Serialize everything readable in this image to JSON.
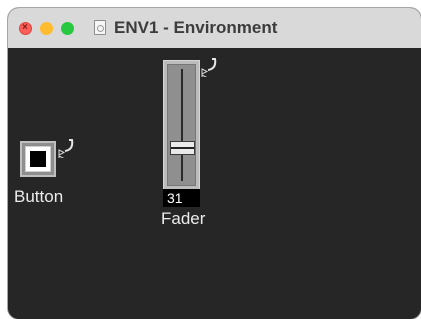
{
  "window": {
    "title": "ENV1 - Environment",
    "traffic_lights": {
      "close": {
        "color": "#fe5f57",
        "icon": "close-x-icon"
      },
      "minimize": {
        "color": "#febc2e"
      },
      "zoom": {
        "color": "#28c840"
      }
    },
    "document_icon": "document-icon"
  },
  "canvas": {
    "background": "#262626",
    "objects": {
      "button": {
        "label": "Button",
        "cable_icon": "cable-outlet-icon"
      },
      "fader": {
        "label": "Fader",
        "value": "31",
        "cable_icon": "cable-outlet-icon"
      }
    }
  }
}
